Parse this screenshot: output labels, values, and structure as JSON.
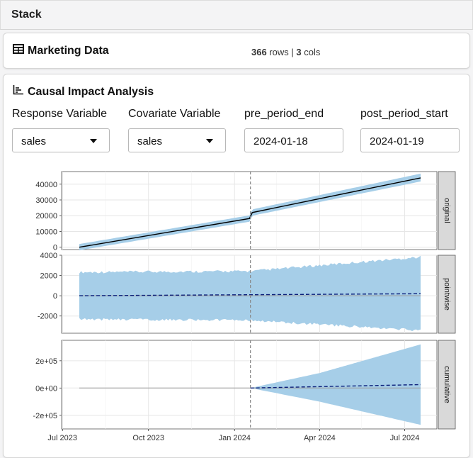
{
  "topbar": {
    "title": "Stack"
  },
  "dataset_card": {
    "title": "Marketing Data",
    "rows": "366",
    "rows_label": "rows",
    "separator": "|",
    "cols": "3",
    "cols_label": "cols"
  },
  "analysis_card": {
    "title": "Causal Impact Analysis",
    "controls": {
      "response_label": "Response Variable",
      "response_value": "sales",
      "covariate_label": "Covariate Variable",
      "covariate_value": "sales",
      "pre_end_label": "pre_period_end",
      "pre_end_value": "2024-01-18",
      "post_start_label": "post_period_start",
      "post_start_value": "2024-01-19"
    }
  },
  "colors": {
    "band": "#a6cee8",
    "strip": "#d9d9d9",
    "prediction": "#0b1f7a",
    "original": "#000000",
    "intervention": "#888888"
  },
  "chart_data": {
    "type": "line",
    "title": "",
    "x_tick_labels": [
      "Jul 2023",
      "Oct 2023",
      "Jan 2024",
      "Apr 2024",
      "Jul 2024"
    ],
    "x_ticks": [
      "2023-07-01",
      "2023-10-01",
      "2024-01-01",
      "2024-04-01",
      "2024-07-01"
    ],
    "x_start": "2023-07-19",
    "x_end": "2024-07-18",
    "intervention": "2024-01-18",
    "grid": true,
    "panels": [
      {
        "name": "original",
        "y_ticks": [
          "0",
          "10000",
          "20000",
          "30000",
          "40000"
        ],
        "y_tick_values": [
          0,
          10000,
          20000,
          30000,
          40000
        ],
        "ylim": [
          -1500,
          48000
        ],
        "series": [
          {
            "x": [
              "2023-07-19",
              "2024-01-17",
              "2024-01-20",
              "2024-07-18"
            ],
            "y": [
              0,
              18200,
              22000,
              44000
            ]
          }
        ],
        "band": {
          "x": [
            "2023-07-19",
            "2024-01-17",
            "2024-01-20",
            "2024-07-18"
          ],
          "upper": [
            2000,
            20200,
            24000,
            46700
          ],
          "lower": [
            -2000,
            16200,
            20000,
            41700
          ]
        }
      },
      {
        "name": "pointwise",
        "y_ticks": [
          "-2000",
          "0",
          "2000",
          "4000"
        ],
        "y_tick_values": [
          -2000,
          0,
          2000,
          4000
        ],
        "ylim": [
          -3700,
          4000
        ],
        "series": [
          {
            "style": "dashed",
            "x": [
              "2023-07-19",
              "2024-07-18"
            ],
            "y": [
              0,
              200
            ]
          }
        ],
        "band": {
          "x": [
            "2023-07-19",
            "2024-01-18",
            "2024-07-18"
          ],
          "upper": [
            2200,
            2300,
            3700
          ],
          "lower": [
            -2200,
            -2300,
            -3300
          ]
        }
      },
      {
        "name": "cumulative",
        "y_ticks": [
          "2e+05",
          "0e+00",
          "-2e+05"
        ],
        "y_tick_values": [
          200000,
          0,
          -200000
        ],
        "ylim": [
          -300000,
          350000
        ],
        "series": [
          {
            "style": "dashed",
            "x": [
              "2024-01-18",
              "2024-07-18"
            ],
            "y": [
              0,
              25000
            ]
          }
        ],
        "band": {
          "x": [
            "2024-01-18",
            "2024-04-01",
            "2024-07-18"
          ],
          "upper": [
            0,
            110000,
            320000
          ],
          "lower": [
            0,
            -100000,
            -270000
          ]
        }
      }
    ]
  }
}
